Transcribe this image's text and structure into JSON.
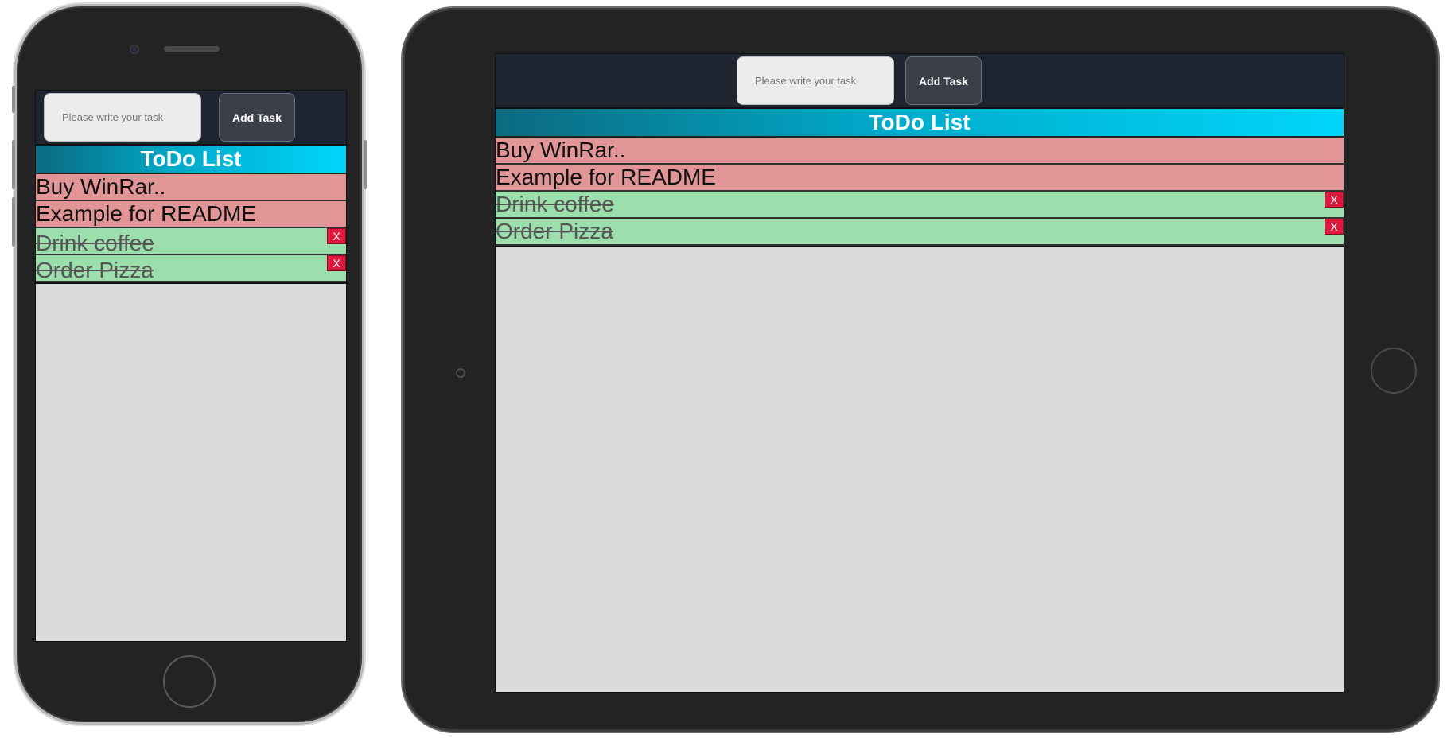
{
  "input": {
    "placeholder": "Please write your task"
  },
  "add_button": {
    "label": "Add Task"
  },
  "list_title": "ToDo List",
  "delete_label": "X",
  "todos": [
    {
      "text": "Buy WinRar..",
      "status": "pending"
    },
    {
      "text": "Example for README",
      "status": "pending"
    },
    {
      "text": "Drink coffee",
      "status": "done"
    },
    {
      "text": "Order Pizza",
      "status": "done"
    }
  ],
  "colors": {
    "pending": "#e29596",
    "done": "#9ddfac",
    "header": "#1f2530",
    "delete": "#dc1a3e",
    "title_gradient_start": "#0b6a80",
    "title_gradient_end": "#00d6fa"
  }
}
